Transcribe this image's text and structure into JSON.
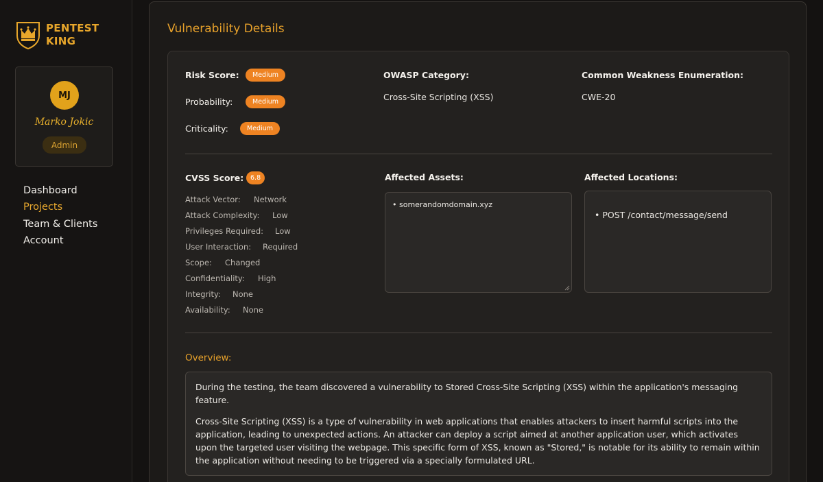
{
  "sidebar": {
    "logo_line1": "PENTEST",
    "logo_line2": "KING",
    "profile": {
      "initials": "MJ",
      "name": "Marko Jokic",
      "role": "Admin"
    },
    "nav": [
      {
        "label": "Dashboard",
        "active": false
      },
      {
        "label": "Projects",
        "active": true
      },
      {
        "label": "Team & Clients",
        "active": false
      },
      {
        "label": "Account",
        "active": false
      }
    ]
  },
  "main": {
    "title": "Vulnerability Details",
    "risk": {
      "risk_score_label": "Risk Score:",
      "risk_score_value": "Medium",
      "probability_label": "Probability:",
      "probability_value": "Medium",
      "criticality_label": "Criticality:",
      "criticality_value": "Medium"
    },
    "owasp": {
      "label": "OWASP Category:",
      "value": "Cross-Site Scripting (XSS)"
    },
    "cwe": {
      "label": "Common Weakness Enumeration:",
      "value": "CWE-20"
    },
    "cvss": {
      "label": "CVSS Score:",
      "score": "6.8",
      "metrics": [
        {
          "label": "Attack Vector:",
          "value": "Network"
        },
        {
          "label": "Attack Complexity:",
          "value": "Low"
        },
        {
          "label": "Privileges Required:",
          "value": "Low"
        },
        {
          "label": "User Interaction:",
          "value": "Required"
        },
        {
          "label": "Scope:",
          "value": "Changed"
        },
        {
          "label": "Confidentiality:",
          "value": "High"
        },
        {
          "label": "Integrity:",
          "value": "None"
        },
        {
          "label": "Availability:",
          "value": "None"
        }
      ]
    },
    "affected_assets": {
      "label": "Affected Assets:",
      "items": [
        "• somerandomdomain.xyz"
      ]
    },
    "affected_locations": {
      "label": "Affected Locations:",
      "items": [
        "•  POST /contact/message/send"
      ]
    },
    "overview": {
      "label": "Overview:",
      "paragraphs": [
        "During the testing, the team discovered a vulnerability to Stored Cross-Site Scripting (XSS) within the application's messaging feature.",
        "Cross-Site Scripting (XSS) is a type of vulnerability in web applications that enables attackers to insert harmful scripts into the application, leading to unexpected actions. An attacker can deploy a script aimed at another application user, which activates upon the targeted user visiting the webpage. This specific form of XSS, known as \"Stored,\" is notable for its ability to remain within the application without needing to be triggered via a specially formulated URL."
      ]
    }
  },
  "colors": {
    "accent": "#e8a22b",
    "pill": "#ee8322",
    "background": "#141211"
  }
}
